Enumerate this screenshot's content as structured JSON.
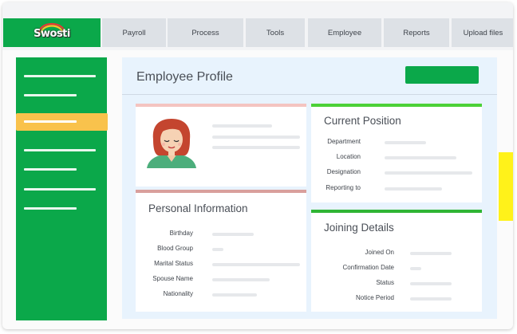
{
  "app": {
    "logo_text": "Swosti"
  },
  "nav": {
    "tabs": [
      {
        "label": "Payroll"
      },
      {
        "label": "Process"
      },
      {
        "label": "Tools"
      },
      {
        "label": "Employee"
      },
      {
        "label": "Reports"
      },
      {
        "label": "Upload files"
      }
    ]
  },
  "main": {
    "title": "Employee Profile"
  },
  "current_position": {
    "title": "Current Position",
    "fields": [
      {
        "label": "Department"
      },
      {
        "label": "Location"
      },
      {
        "label": "Designation"
      },
      {
        "label": "Reporting to"
      }
    ]
  },
  "personal_information": {
    "title": "Personal Information",
    "fields": [
      {
        "label": "Birthday"
      },
      {
        "label": "Blood Group"
      },
      {
        "label": "Marital Status"
      },
      {
        "label": "Spouse Name"
      },
      {
        "label": "Nationality"
      }
    ]
  },
  "joining_details": {
    "title": "Joining Details",
    "fields": [
      {
        "label": "Joined On"
      },
      {
        "label": "Confirmation Date"
      },
      {
        "label": "Status"
      },
      {
        "label": "Notice Period"
      }
    ]
  },
  "colors": {
    "brand_green": "#0ba84a",
    "active_yellow": "#f9c24c",
    "profile_bar": "#f4c4c0",
    "position_bar": "#4cd137",
    "personal_bar": "#d99f9c",
    "joining_bar": "#2fb534",
    "scroll_accent": "#fff21a"
  },
  "icons": {
    "avatar": "female-avatar-icon",
    "logo_arc": "rainbow-arc-icon"
  }
}
